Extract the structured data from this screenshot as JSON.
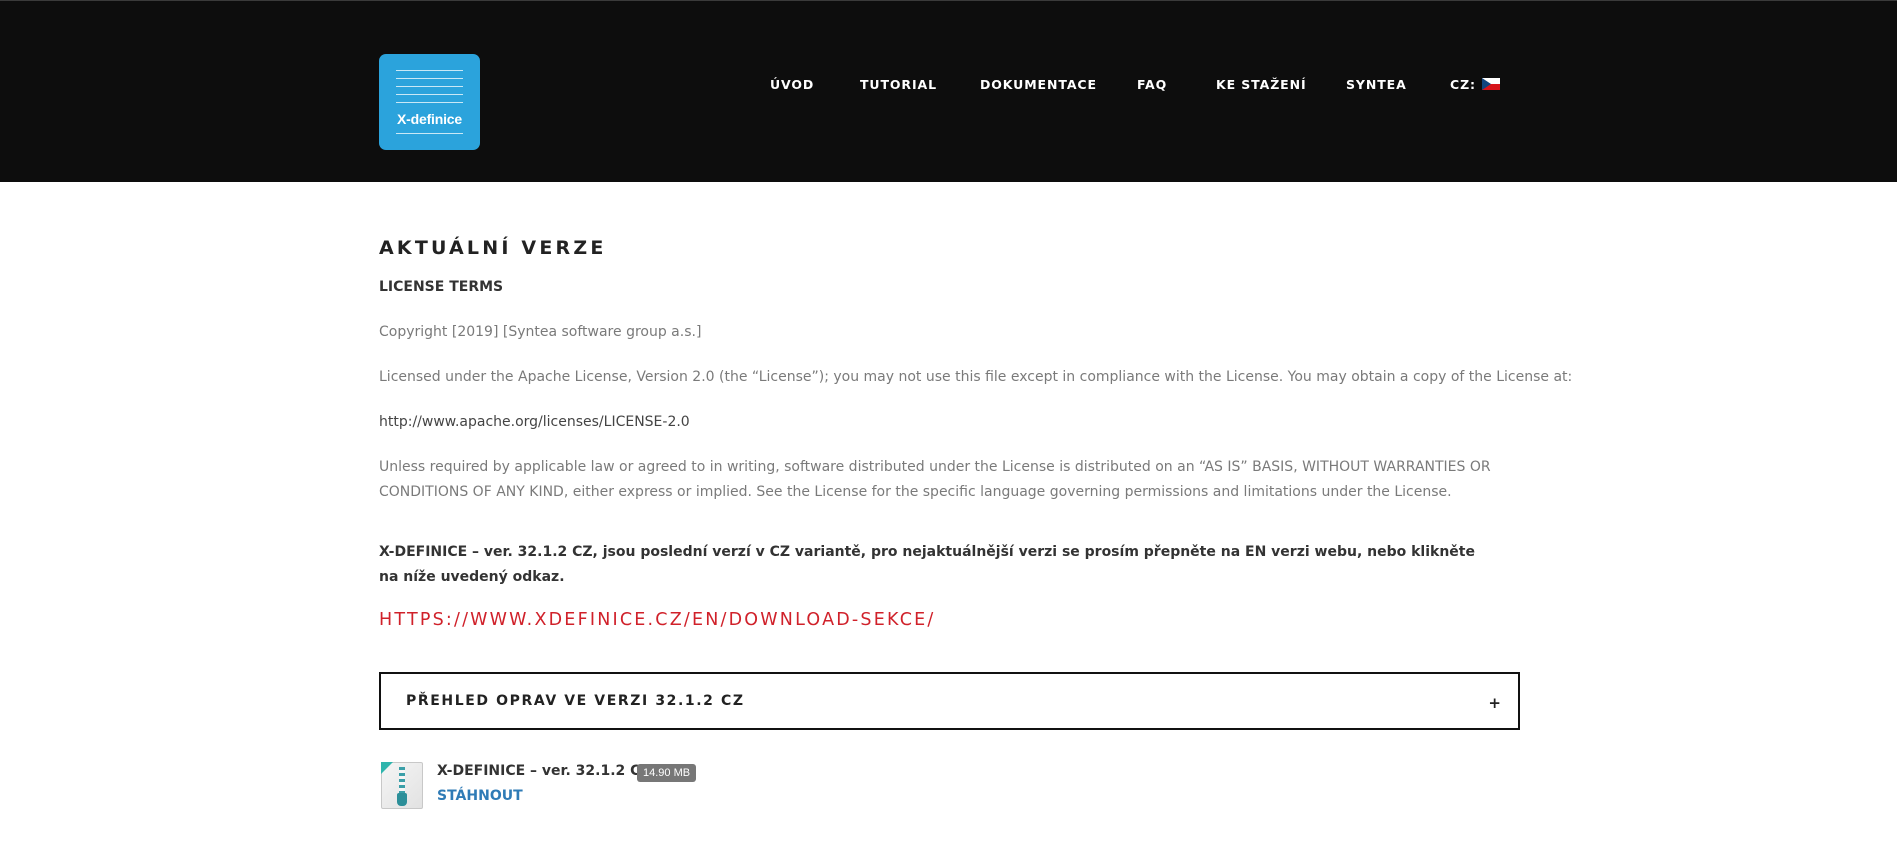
{
  "header": {
    "logo_text": "X-definice",
    "nav": [
      {
        "label": "ÚVOD"
      },
      {
        "label": "TUTORIAL"
      },
      {
        "label": "DOKUMENTACE"
      },
      {
        "label": "FAQ"
      },
      {
        "label": "KE STAŽENÍ"
      },
      {
        "label": "SYNTEA"
      },
      {
        "label": "CZ:"
      }
    ],
    "language_flag_icon": "czech-flag-icon"
  },
  "main": {
    "title": "AKTUÁLNÍ VERZE",
    "license_heading": "LICENSE TERMS",
    "copyright": "Copyright [2019] [Syntea software group a.s.]",
    "licensed_text": "Licensed under the Apache License, Version 2.0 (the “License”); you may not use this file except in compliance with the License. You may obtain a copy of the License at:",
    "license_url": "http://www.apache.org/licenses/LICENSE-2.0",
    "unless_line1": "Unless required by applicable law or agreed to in writing, software distributed under the License is distributed on an “AS IS” BASIS,  WITHOUT WARRANTIES OR",
    "unless_line2": "CONDITIONS OF ANY KIND, either express or implied. See the License for the specific language governing permissions and limitations under the License.",
    "notice": "X-DEFINICE – ver. 32.1.2 CZ, jsou poslední verzí v CZ variantě, pro nejaktuálnější verzi se prosím přepněte na EN verzi webu, nebo klikněte na níže uvedený odkaz.",
    "en_link": "HTTPS://WWW.XDEFINICE.CZ/EN/DOWNLOAD-SEKCE/",
    "accordion": {
      "title": "PŘEHLED OPRAV VE VERZI 32.1.2 CZ",
      "toggle": "+"
    },
    "download": {
      "file_title": "X-DEFINICE – ver. 32.1.2 CZ",
      "size": "14.90 MB",
      "link_label": "STÁHNOUT",
      "icon": "zip-file-icon"
    }
  }
}
